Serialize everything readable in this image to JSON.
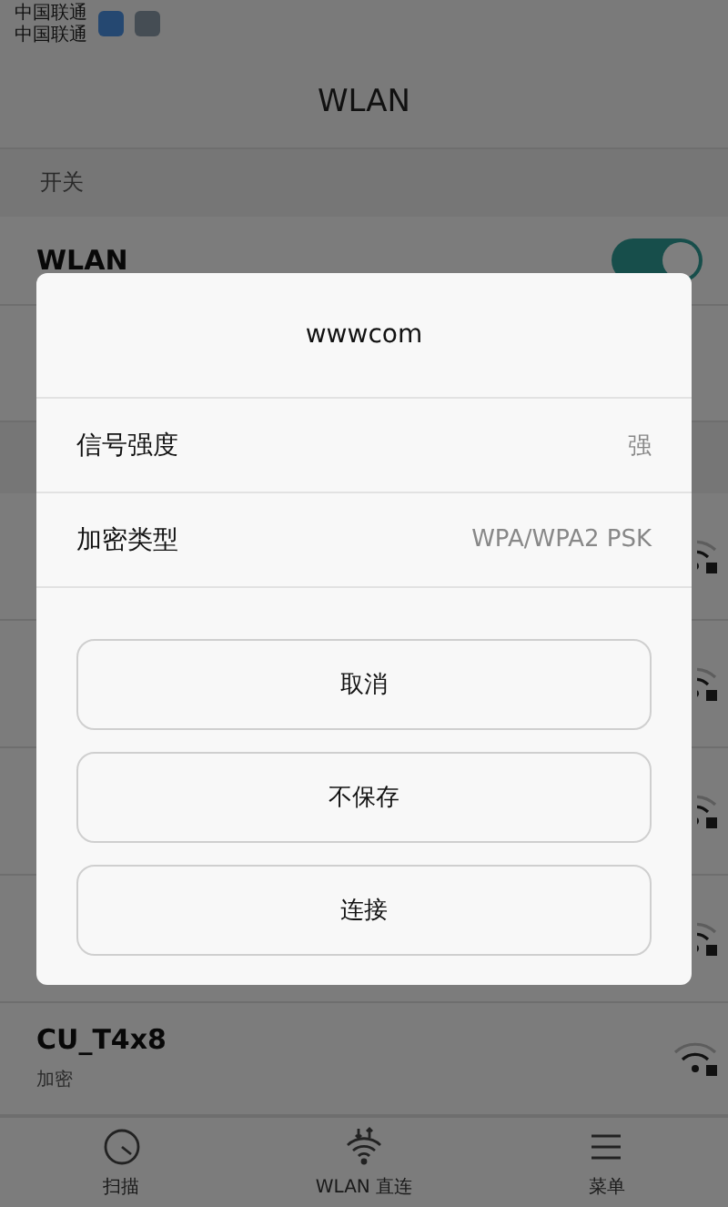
{
  "status_bar": {
    "carrier_lines": [
      "中国联通",
      "中国联通"
    ]
  },
  "header": {
    "title": "WLAN"
  },
  "switch_section": {
    "label": "开关",
    "wlan": {
      "label": "WLAN",
      "on": true
    }
  },
  "networks": [
    {
      "secured": true
    },
    {
      "secured": true
    },
    {
      "secured": true
    },
    {
      "secured": true
    },
    {
      "name": "CU_T4x8",
      "status": "加密",
      "secured": true
    }
  ],
  "dialog": {
    "title": "wwwcom",
    "rows": [
      {
        "label": "信号强度",
        "value": "强"
      },
      {
        "label": "加密类型",
        "value": "WPA/WPA2 PSK"
      }
    ],
    "buttons": [
      "取消",
      "不保存",
      "连接"
    ]
  },
  "bottom_nav": [
    {
      "kind": "scan",
      "label": "扫描"
    },
    {
      "kind": "direct",
      "label": "WLAN 直连"
    },
    {
      "kind": "menu",
      "label": "菜单"
    }
  ]
}
